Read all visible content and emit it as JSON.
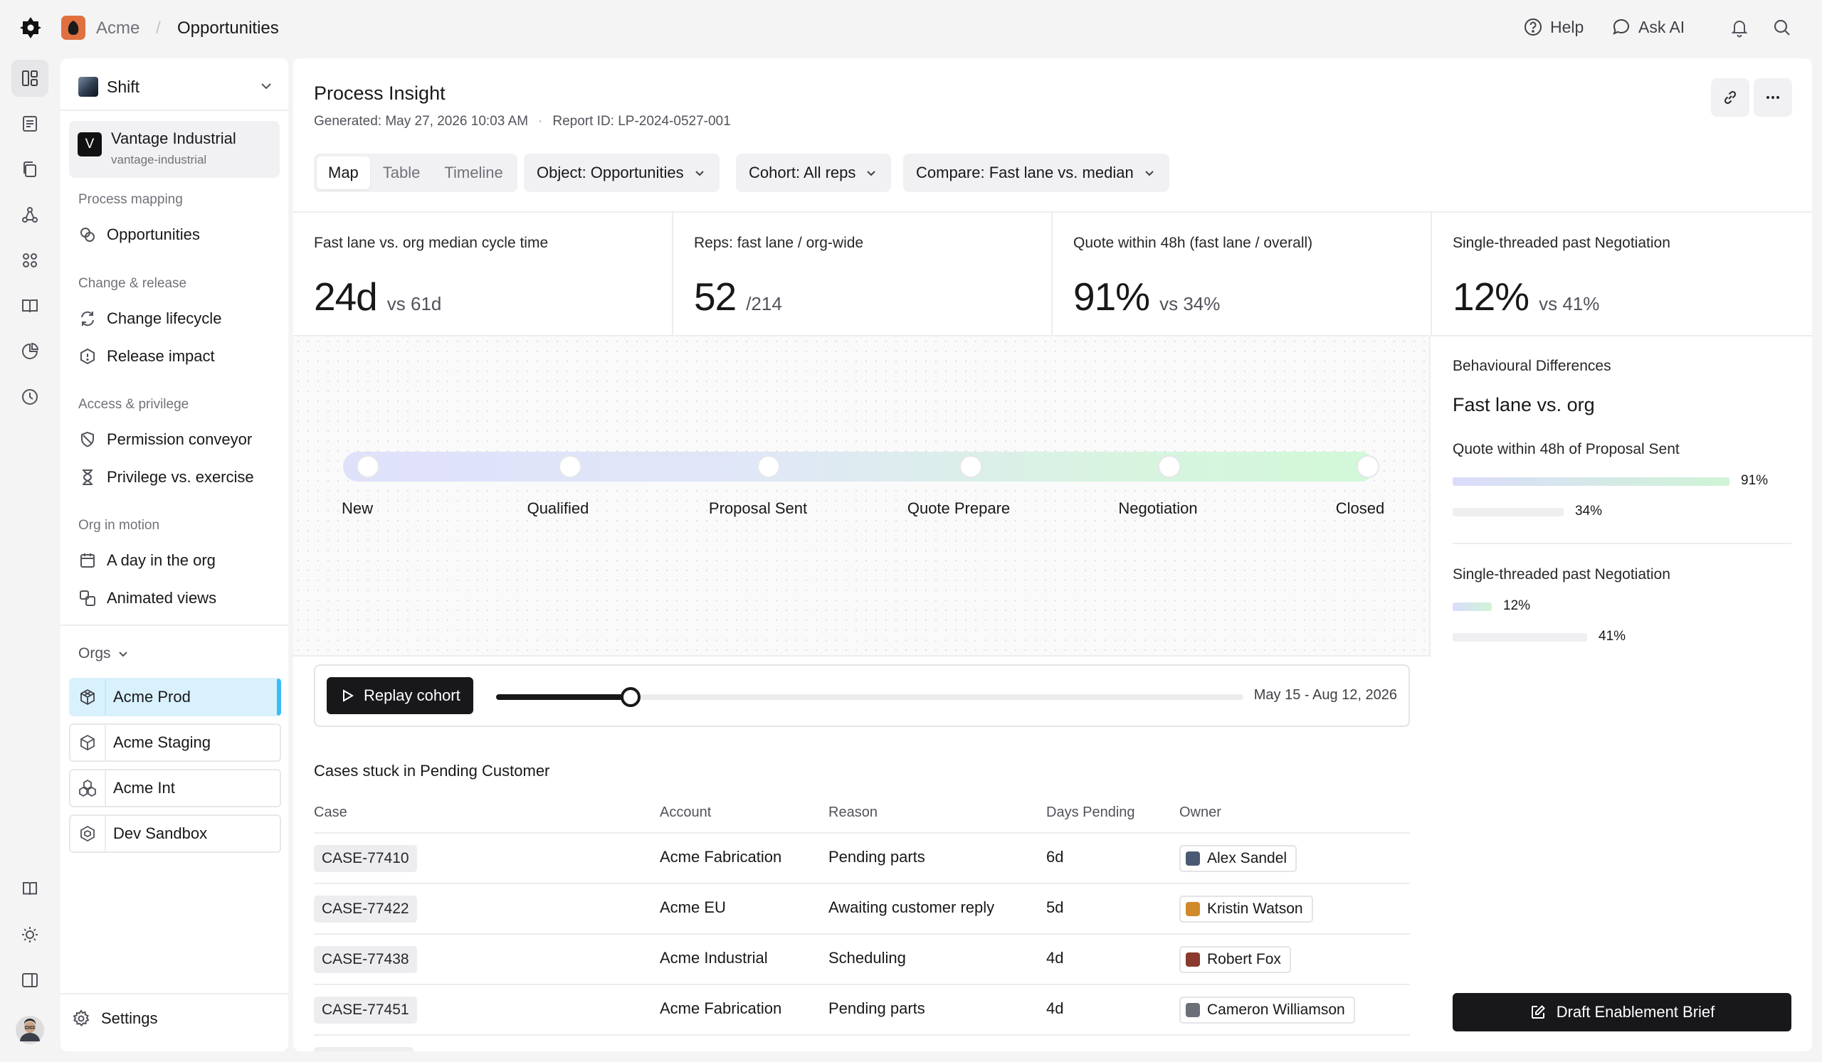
{
  "breadcrumb": {
    "org": "Acme",
    "separator": "/",
    "page": "Opportunities"
  },
  "topbar": {
    "help": "Help",
    "ask_ai": "Ask AI"
  },
  "sidebar": {
    "workspace": "Shift",
    "org_card": {
      "initial": "V",
      "name": "Vantage Industrial",
      "slug": "vantage-industrial"
    },
    "sections": [
      {
        "label": "Process mapping",
        "items": [
          {
            "label": "Opportunities",
            "icon": "opportunities-icon"
          }
        ]
      },
      {
        "label": "Change & release",
        "items": [
          {
            "label": "Change lifecycle",
            "icon": "refresh-icon"
          },
          {
            "label": "Release impact",
            "icon": "alert-hexagon-icon"
          }
        ]
      },
      {
        "label": "Access & privilege",
        "items": [
          {
            "label": "Permission conveyor",
            "icon": "shield-icon"
          },
          {
            "label": "Privilege vs. exercise",
            "icon": "hourglass-icon"
          }
        ]
      },
      {
        "label": "Org in motion",
        "items": [
          {
            "label": "A day in the org",
            "icon": "calendar-icon"
          },
          {
            "label": "Animated views",
            "icon": "layers-icon"
          }
        ]
      }
    ],
    "orgs_label": "Orgs",
    "orgs": [
      {
        "label": "Acme Prod",
        "icon": "cube-icon",
        "active": true
      },
      {
        "label": "Acme Staging",
        "icon": "box-icon",
        "active": false
      },
      {
        "label": "Acme Int",
        "icon": "boxes-icon",
        "active": false
      },
      {
        "label": "Dev Sandbox",
        "icon": "sandbox-icon",
        "active": false
      }
    ],
    "settings": "Settings"
  },
  "header": {
    "title": "Process Insight",
    "generated": "Generated: May 27, 2026 10:03 AM",
    "meta_separator": "·",
    "report_id": "Report ID: LP-2024-0527-001"
  },
  "toolbar": {
    "tabs": [
      "Map",
      "Table",
      "Timeline"
    ],
    "active_tab": "Map",
    "object": "Object: Opportunities",
    "cohort": "Cohort: All reps",
    "compare": "Compare: Fast lane vs. median"
  },
  "kpis": [
    {
      "label": "Fast lane vs. org median cycle time",
      "value": "24d",
      "compare": "vs 61d"
    },
    {
      "label": "Reps: fast lane / org-wide",
      "value": "52",
      "compare": "/214"
    },
    {
      "label": "Quote within 48h (fast lane / overall)",
      "value": "91%",
      "compare": "vs 34%"
    },
    {
      "label": "Single-threaded past Negotiation",
      "value": "12%",
      "compare": "vs 41%"
    }
  ],
  "stages": [
    "New",
    "Qualified",
    "Proposal Sent",
    "Quote Prepare",
    "Negotiation",
    "Closed"
  ],
  "replay": {
    "button": "Replay cohort",
    "range": "May 15 - Aug 12, 2026",
    "progress": 0.18
  },
  "table": {
    "title": "Cases stuck in Pending Customer",
    "columns": [
      "Case",
      "Account",
      "Reason",
      "Days Pending",
      "Owner"
    ],
    "rows": [
      {
        "case": "CASE-77410",
        "account": "Acme Fabrication",
        "reason": "Pending parts",
        "days": "6d",
        "owner": "Alex Sandel",
        "avatar_color": "#4b5a74"
      },
      {
        "case": "CASE-77422",
        "account": "Acme EU",
        "reason": "Awaiting customer reply",
        "days": "5d",
        "owner": "Kristin Watson",
        "avatar_color": "#d08a2c"
      },
      {
        "case": "CASE-77438",
        "account": "Acme Industrial",
        "reason": "Scheduling",
        "days": "4d",
        "owner": "Robert Fox",
        "avatar_color": "#8a3b2e"
      },
      {
        "case": "CASE-77451",
        "account": "Acme Fabrication",
        "reason": "Pending parts",
        "days": "4d",
        "owner": "Cameron Williamson",
        "avatar_color": "#6b6f78"
      }
    ]
  },
  "right_panel": {
    "label": "Behavioural Differences",
    "title": "Fast lane vs. org",
    "metrics": [
      {
        "label": "Quote within 48h of Proposal Sent",
        "fast": 91,
        "fast_label": "91%",
        "org": 34,
        "org_label": "34%"
      },
      {
        "label": "Single-threaded past Negotiation",
        "fast": 12,
        "fast_label": "12%",
        "org": 41,
        "org_label": "41%"
      }
    ],
    "cta": "Draft Enablement Brief"
  },
  "colors": {
    "accent": "#18181b",
    "active_org_bg": "#d9f1fd",
    "active_org_border": "#38bdf8",
    "fast_lane_gradient_start": "#dcdcfb",
    "fast_lane_gradient_end": "#d2f8d8",
    "org_avatar": "#e0703f"
  }
}
